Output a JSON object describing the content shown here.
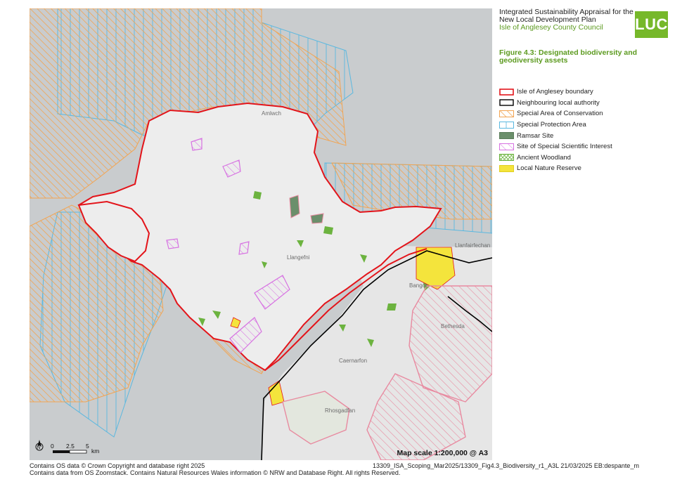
{
  "header": {
    "line1": "Integrated Sustainability Appraisal for the",
    "line2": "New Local Development Plan",
    "line3": "Isle of Anglesey County Council",
    "logo_text": "LUC"
  },
  "figure_title": {
    "line1": "Figure 4.3: Designated biodiversity and",
    "line2": "geodiversity assets"
  },
  "legend": [
    {
      "label": "Isle of Anglesey boundary",
      "icon": "boundary-red-swatch"
    },
    {
      "label": "Neighbouring local authority",
      "icon": "boundary-black-swatch"
    },
    {
      "label": "Special Area of Conservation",
      "icon": "orange-hatch-swatch"
    },
    {
      "label": "Special Protection Area",
      "icon": "blue-hatch-swatch"
    },
    {
      "label": "Ramsar Site",
      "icon": "dark-green-swatch"
    },
    {
      "label": "Site of Special Scientific Interest",
      "icon": "pink-hatch-swatch"
    },
    {
      "label": "Ancient Woodland",
      "icon": "green-crosshatch-swatch"
    },
    {
      "label": "Local Nature Reserve",
      "icon": "yellow-swatch"
    }
  ],
  "map": {
    "places": [
      "Amlwch",
      "Llangefni",
      "Bangor",
      "Llanfairfechan",
      "Bethesda",
      "Caernarfon",
      "Rhosgadfan"
    ],
    "scale_text": "Map scale 1:200,000 @ A3",
    "scalebar_labels": [
      "0",
      "2.5",
      "5"
    ],
    "scalebar_unit": "km"
  },
  "footer": {
    "left_line1": "Contains OS data © Crown Copyright and database right 2025",
    "left_line2": "Contains data from OS Zoomstack. Contains Natural Resources Wales information © NRW and Database Right. All rights Reserved.",
    "right_line1": "13309_ISA_Scoping_Mar2025/13309_Fig4.3_Biodiversity_r1_A3L 21/03/2025 EB:despante_m"
  },
  "colors": {
    "sea": "#c9ccce",
    "land": "#ededed",
    "anglesey_boundary": "#e3141a",
    "neighbouring_boundary": "#000000",
    "sac_hatch": "#f2a451",
    "spa_hatch": "#5ab8e0",
    "ramsar": "#6b8f6b",
    "sssi": "#d772e2",
    "ancient_woodland": "#6cb33f",
    "lnr": "#f4e43c"
  }
}
